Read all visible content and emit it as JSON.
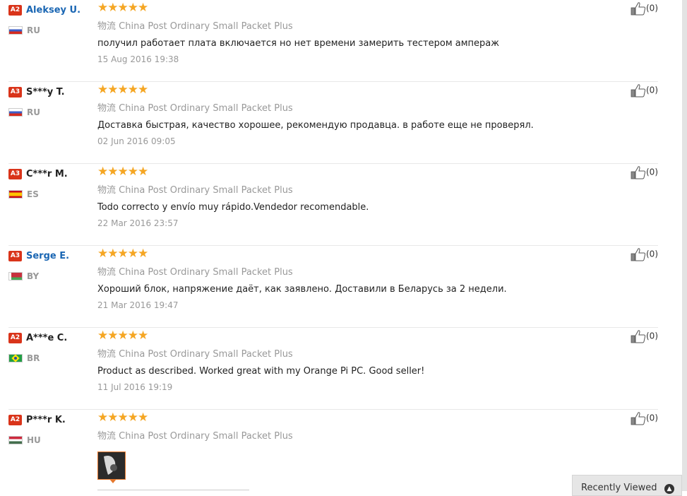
{
  "reviews": [
    {
      "level": "A2",
      "name": "Aleksey U.",
      "name_is_link": true,
      "country": "RU",
      "flag": "ru",
      "stars": "★★★★★",
      "logistics_cn": "物流",
      "logistics": "China Post Ordinary Small Packet Plus",
      "text": "получил работает плата включается но нет времени замерить тестером ампераж",
      "date": "15 Aug 2016 19:38",
      "helpful": "(0)"
    },
    {
      "level": "A3",
      "name": "S***y T.",
      "name_is_link": false,
      "country": "RU",
      "flag": "ru",
      "stars": "★★★★★",
      "logistics_cn": "物流",
      "logistics": "China Post Ordinary Small Packet Plus",
      "text": "Доставка быстрая, качество хорошее, рекомендую продавца. в работе еще не проверял.",
      "date": "02 Jun 2016 09:05",
      "helpful": "(0)"
    },
    {
      "level": "A3",
      "name": "C***r M.",
      "name_is_link": false,
      "country": "ES",
      "flag": "es",
      "stars": "★★★★★",
      "logistics_cn": "物流",
      "logistics": "China Post Ordinary Small Packet Plus",
      "text": "Todo correcto y envío muy rápido.Vendedor recomendable.",
      "date": "22 Mar 2016 23:57",
      "helpful": "(0)"
    },
    {
      "level": "A3",
      "name": "Serge E.",
      "name_is_link": true,
      "country": "BY",
      "flag": "by",
      "stars": "★★★★★",
      "logistics_cn": "物流",
      "logistics": "China Post Ordinary Small Packet Plus",
      "text": "Хороший блок, напряжение даёт, как заявлено. Доставили в Беларусь за 2 недели.",
      "date": "21 Mar 2016 19:47",
      "helpful": "(0)"
    },
    {
      "level": "A2",
      "name": "A***e C.",
      "name_is_link": false,
      "country": "BR",
      "flag": "br",
      "stars": "★★★★★",
      "logistics_cn": "物流",
      "logistics": "China Post Ordinary Small Packet Plus",
      "text": "Product as described. Worked great with my Orange Pi PC. Good seller!",
      "date": "11 Jul 2016 19:19",
      "helpful": "(0)"
    },
    {
      "level": "A2",
      "name": "P***r K.",
      "name_is_link": false,
      "country": "HU",
      "flag": "hu",
      "stars": "★★★★★",
      "logistics_cn": "物流",
      "logistics": "China Post Ordinary Small Packet Plus",
      "text": "",
      "date": "",
      "helpful": "(0)",
      "has_photo": true
    }
  ],
  "star_rating": 5,
  "recently_viewed": "Recently Viewed",
  "colors": {
    "accent": "#f5a623",
    "level_badge": "#d9341a",
    "link": "#1a66b3"
  }
}
